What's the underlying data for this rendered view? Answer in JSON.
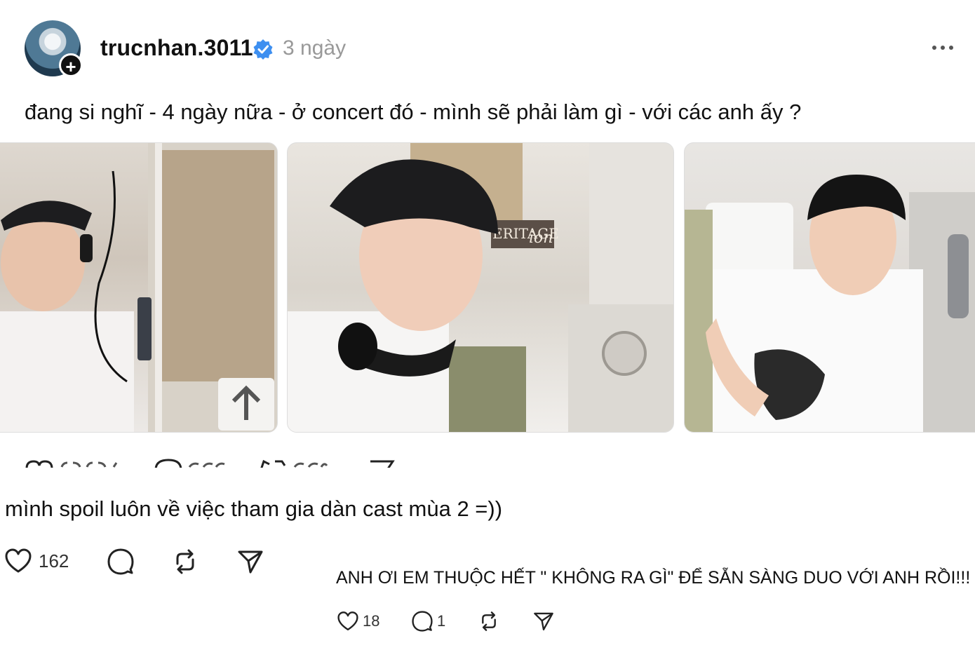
{
  "post": {
    "username": "trucnhan.3011",
    "time": "3 ngày",
    "text": "đang si nghĩ - 4 ngày nữa - ở concert đó - mình sẽ phải làm gì - với các anh ấy ?",
    "photo_text_1": "ERITAGE",
    "photo_text_2": "ion"
  },
  "reply1": {
    "text": "mình spoil luôn về việc tham gia dàn cast mùa 2 =))",
    "likes": "162"
  },
  "reply2": {
    "text": "ANH ƠI EM THUỘC HẾT \" KHÔNG RA GÌ\" ĐỂ SẴN SÀNG DUO VỚI ANH RỒI!!!",
    "likes": "18",
    "comments": "1"
  },
  "colors": {
    "verified": "#3d8ff0",
    "muted": "#999999"
  },
  "icons": [
    "plus-icon",
    "verified-icon",
    "more-icon",
    "heart-icon",
    "comment-icon",
    "repost-icon",
    "share-icon"
  ]
}
